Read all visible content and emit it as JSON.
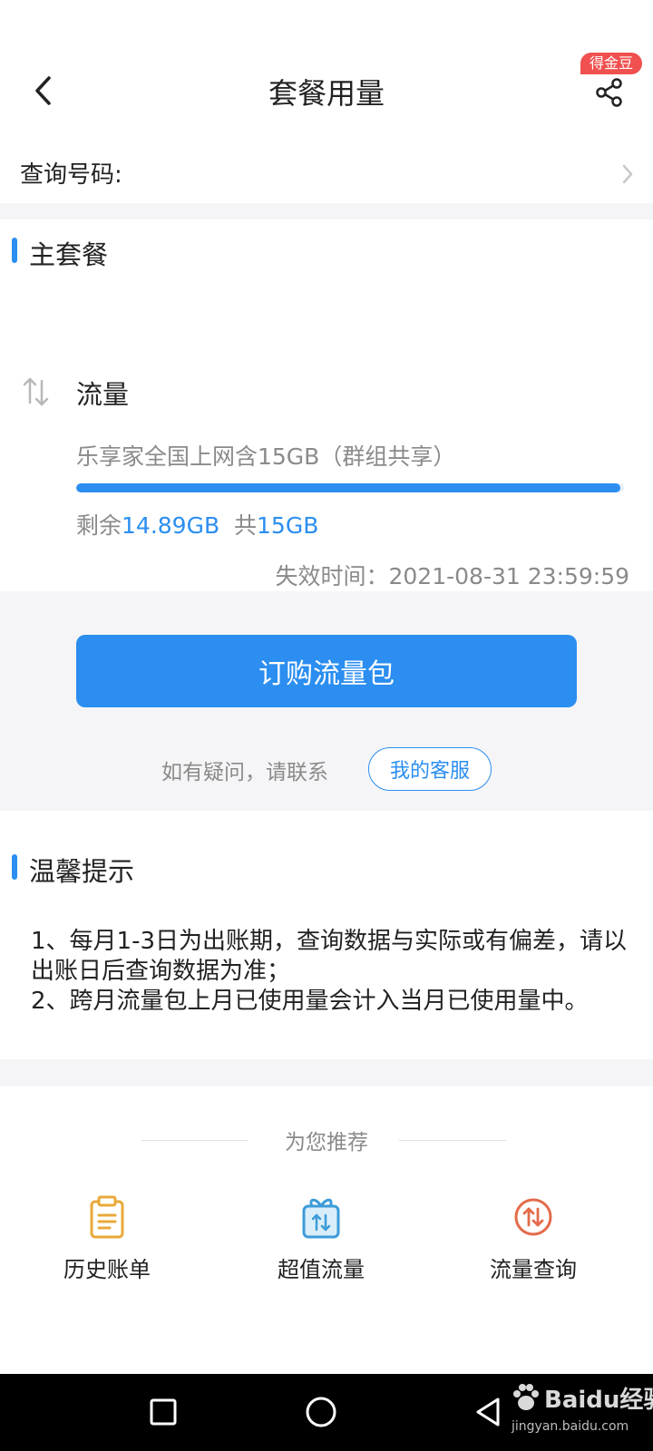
{
  "header": {
    "title": "套餐用量",
    "badge": "得金豆",
    "back_icon": "chevron-left-icon",
    "share_icon": "share-icon"
  },
  "query": {
    "label": "查询号码:",
    "chevron_icon": "chevron-right-icon"
  },
  "main_plan": {
    "section_title": "主套餐",
    "flow_icon": "transfer-arrows-icon",
    "flow_label": "流量",
    "plan_name": "乐享家全国上网含15GB（群组共享）",
    "remaining_fraction": 0.9927,
    "remain_prefix": "剩余",
    "remain_value": "14.89GB",
    "total_prefix": "共",
    "total_value": "15GB",
    "expire_label": "失效时间：",
    "expire_value": "2021-08-31 23:59:59"
  },
  "actions": {
    "order_button": "订购流量包",
    "contact_text": "如有疑问，请联系",
    "service_button": "我的客服"
  },
  "tips": {
    "section_title": "温馨提示",
    "lines": [
      "1、每月1-3日为出账期，查询数据与实际或有偏差，请以出账日后查询数据为准；",
      "2、跨月流量包上月已使用量会计入当月已使用量中。"
    ]
  },
  "recommend": {
    "title": "为您推荐",
    "items": [
      {
        "label": "历史账单",
        "icon": "clipboard-icon",
        "color": "#e8a93a"
      },
      {
        "label": "超值流量",
        "icon": "gift-box-icon",
        "color": "#3d9bd8"
      },
      {
        "label": "流量查询",
        "icon": "data-exchange-icon",
        "color": "#e36b4a"
      }
    ]
  },
  "system_nav": {
    "recent_icon": "square-recent-icon",
    "home_icon": "circle-home-icon",
    "back_icon": "triangle-back-icon"
  },
  "watermark": {
    "text": "Baidu经验",
    "sub": "jingyan.baidu.com"
  },
  "colors": {
    "accent": "#2b8ef0",
    "muted_text": "#8a8a8a",
    "band_bg": "#f5f5f7"
  }
}
